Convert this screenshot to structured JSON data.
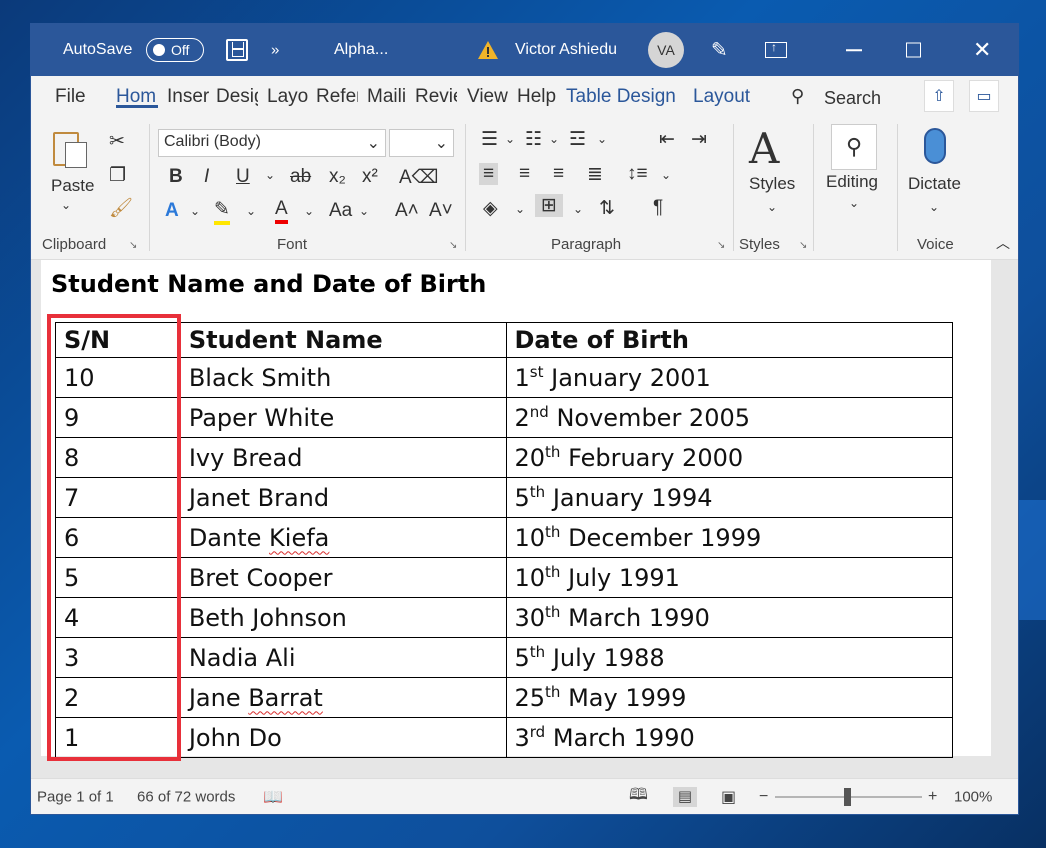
{
  "titlebar": {
    "autosave_label": "AutoSave",
    "autosave_state": "Off",
    "doc_title": "Alpha...",
    "user_name": "Victor Ashiedu",
    "user_initials": "VA",
    "more_label": "»"
  },
  "tabs": [
    "File",
    "Home",
    "Insert",
    "Design",
    "Layout",
    "References",
    "Mailings",
    "Review",
    "View",
    "Help",
    "Table Design",
    "Layout"
  ],
  "tabs_display": [
    "File",
    "Hom",
    "Inser",
    "Desig",
    "Layo",
    "Refer",
    "Maili",
    "Revie",
    "View",
    "Help",
    "Table Design",
    "Layout"
  ],
  "search_label": "Search",
  "ribbon": {
    "clipboard": {
      "paste_label": "Paste",
      "group_label": "Clipboard"
    },
    "font": {
      "font_name": "Calibri (Body)",
      "font_size": "",
      "group_label": "Font",
      "grow": "A^",
      "shrink": "Aˇ",
      "case": "Aa"
    },
    "paragraph": {
      "group_label": "Paragraph"
    },
    "styles": {
      "label": "Styles",
      "group_label": "Styles"
    },
    "editing": {
      "label": "Editing"
    },
    "voice": {
      "label": "Dictate",
      "group_label": "Voice"
    }
  },
  "document": {
    "heading": "Student Name and Date of Birth",
    "columns": [
      "S/N",
      "Student Name",
      "Date of Birth"
    ],
    "rows": [
      {
        "sn": "10",
        "name": "Black Smith",
        "day": "1",
        "suffix": "st",
        "rest": "January 2001"
      },
      {
        "sn": "9",
        "name": "Paper White",
        "day": "2",
        "suffix": "nd",
        "rest": "November 2005"
      },
      {
        "sn": "8",
        "name": "Ivy Bread",
        "day": "20",
        "suffix": "th",
        "rest": "February 2000"
      },
      {
        "sn": "7",
        "name": "Janet Brand",
        "day": "5",
        "suffix": "th",
        "rest": "January 1994"
      },
      {
        "sn": "6",
        "name": "Dante Kiefa",
        "day": "10",
        "suffix": "th",
        "rest": "December 1999"
      },
      {
        "sn": "5",
        "name": "Bret Cooper",
        "day": "10",
        "suffix": "th",
        "rest": "July 1991"
      },
      {
        "sn": "4",
        "name": "Beth Johnson",
        "day": "30",
        "suffix": "th",
        "rest": "March 1990"
      },
      {
        "sn": "3",
        "name": "Nadia Ali",
        "day": "5",
        "suffix": "th",
        "rest": "July 1988"
      },
      {
        "sn": "2",
        "name": "Jane Barrat",
        "day": "25",
        "suffix": "th",
        "rest": "May 1999"
      },
      {
        "sn": "1",
        "name": "John Do",
        "day": "3",
        "suffix": "rd",
        "rest": "March 1990"
      }
    ]
  },
  "statusbar": {
    "page": "Page 1 of 1",
    "words": "66 of 72 words",
    "zoom": "100%"
  },
  "colors": {
    "accent": "#2b579a",
    "highlight": "#e8303a"
  }
}
